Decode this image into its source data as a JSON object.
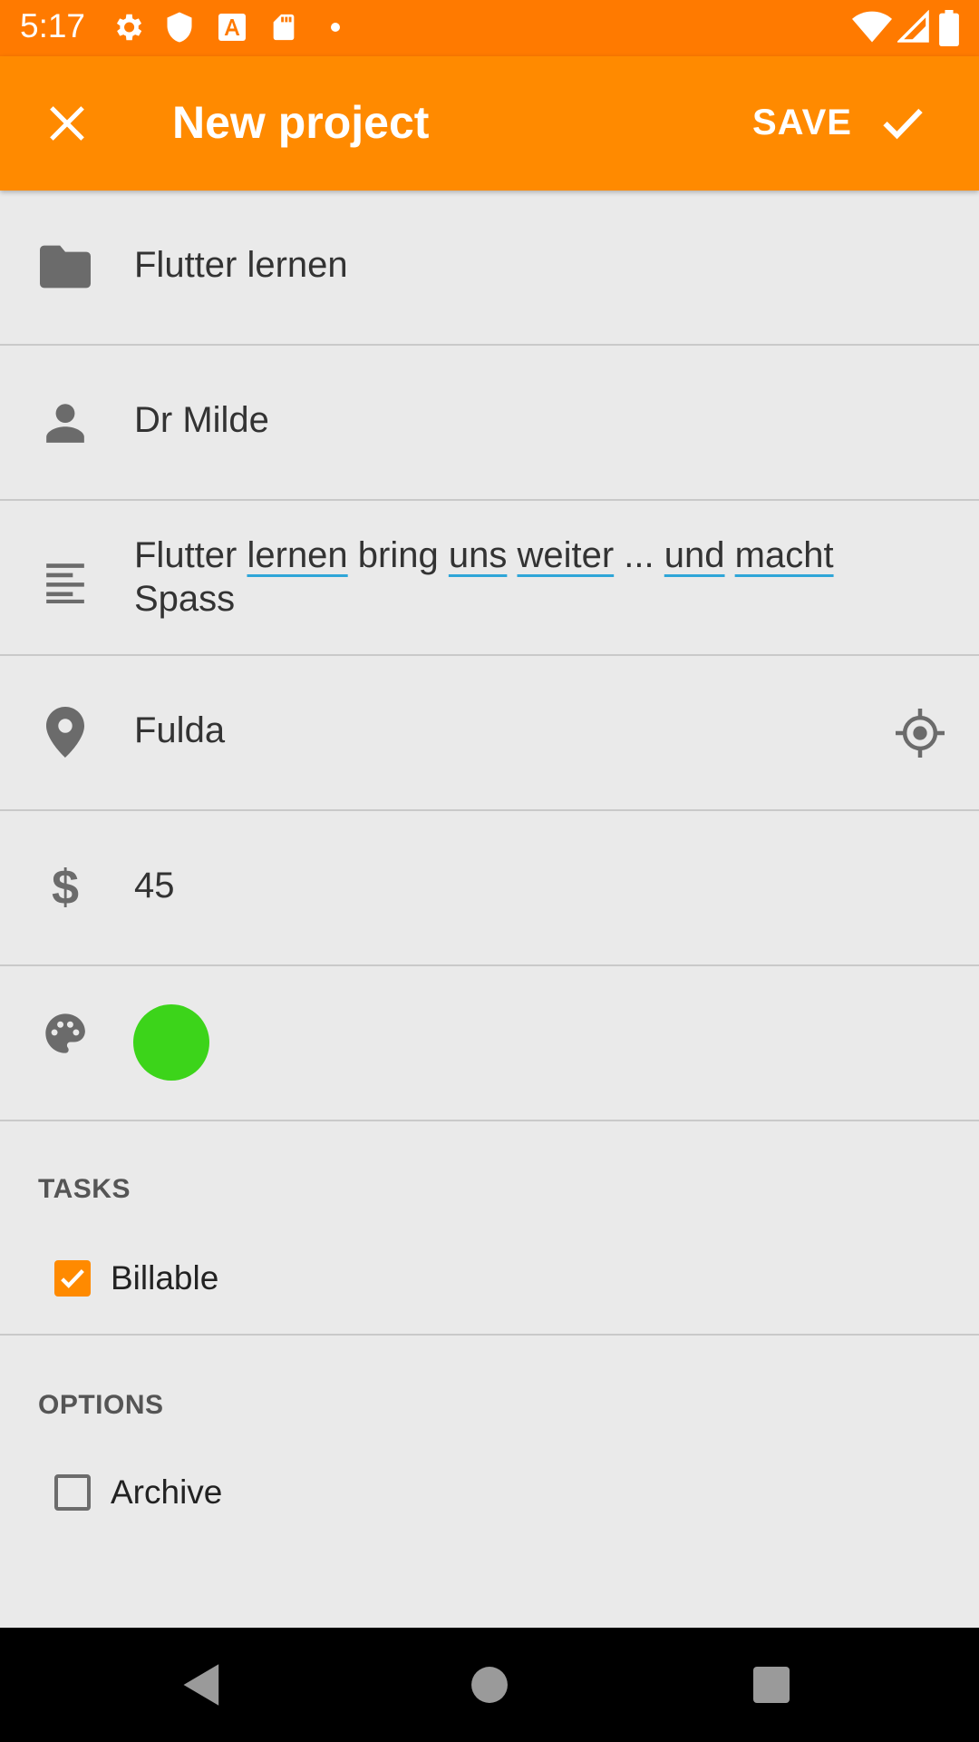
{
  "status_bar": {
    "time": "5:17",
    "left_icons": [
      "gear-icon",
      "shield-icon",
      "font-download-icon",
      "sd-card-icon",
      "dot-icon"
    ],
    "right_icons": [
      "wifi-icon",
      "cellular-signal-icon",
      "battery-icon"
    ]
  },
  "app_bar": {
    "title": "New project",
    "close_icon": "close-icon",
    "save_label": "SAVE",
    "save_icon": "check-icon",
    "color": "#ff8a00"
  },
  "form": {
    "project_name": {
      "icon": "folder-icon",
      "value": "Flutter lernen"
    },
    "client": {
      "icon": "person-icon",
      "value": "Dr Milde"
    },
    "description": {
      "icon": "notes-icon",
      "value": "Flutter lernen bring uns weiter ... und macht Spass",
      "spellcheck_underlined_words": [
        "lernen",
        "uns",
        "weiter",
        "und",
        "macht"
      ]
    },
    "location": {
      "icon": "location-pin-icon",
      "value": "Fulda",
      "action_icon": "my-location-icon"
    },
    "rate": {
      "icon": "dollar-icon",
      "value": "45"
    },
    "color": {
      "icon": "palette-icon",
      "swatch": "#3cd41a"
    }
  },
  "tasks": {
    "title": "TASKS",
    "items": [
      {
        "label": "Billable",
        "checked": true
      }
    ]
  },
  "options": {
    "title": "OPTIONS",
    "items": [
      {
        "label": "Archive",
        "checked": false
      }
    ]
  },
  "nav_bar": {
    "icons": [
      "back-icon",
      "home-icon",
      "recents-icon"
    ]
  },
  "colors": {
    "accent": "#ff8a00",
    "status_bar": "#ff7a00",
    "background": "#eaeaea"
  }
}
